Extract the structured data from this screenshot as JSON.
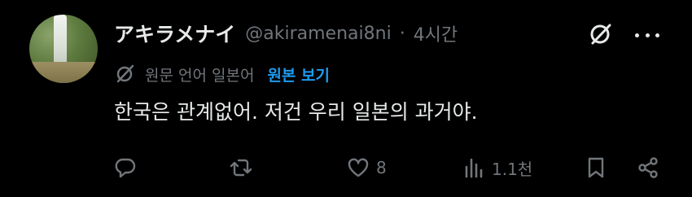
{
  "tweet": {
    "display_name": "アキラメナイ",
    "handle": "@akiramenai8ni",
    "separator": "·",
    "time": "4시간",
    "translation_label": "원문 언어 일본어",
    "show_original_label": "원본 보기",
    "text": "한국은 관계없어. 저건 우리 일본의 과거야."
  },
  "actions": {
    "like_count": "8",
    "views_count": "1.1천"
  },
  "icons": [
    "grok-icon",
    "more-icon",
    "translate-icon",
    "reply-icon",
    "retweet-icon",
    "like-icon",
    "views-icon",
    "bookmark-icon",
    "share-icon"
  ],
  "colors": {
    "background": "#000000",
    "text": "#e7e9ea",
    "muted": "#71767b",
    "link": "#1d9bf0"
  }
}
